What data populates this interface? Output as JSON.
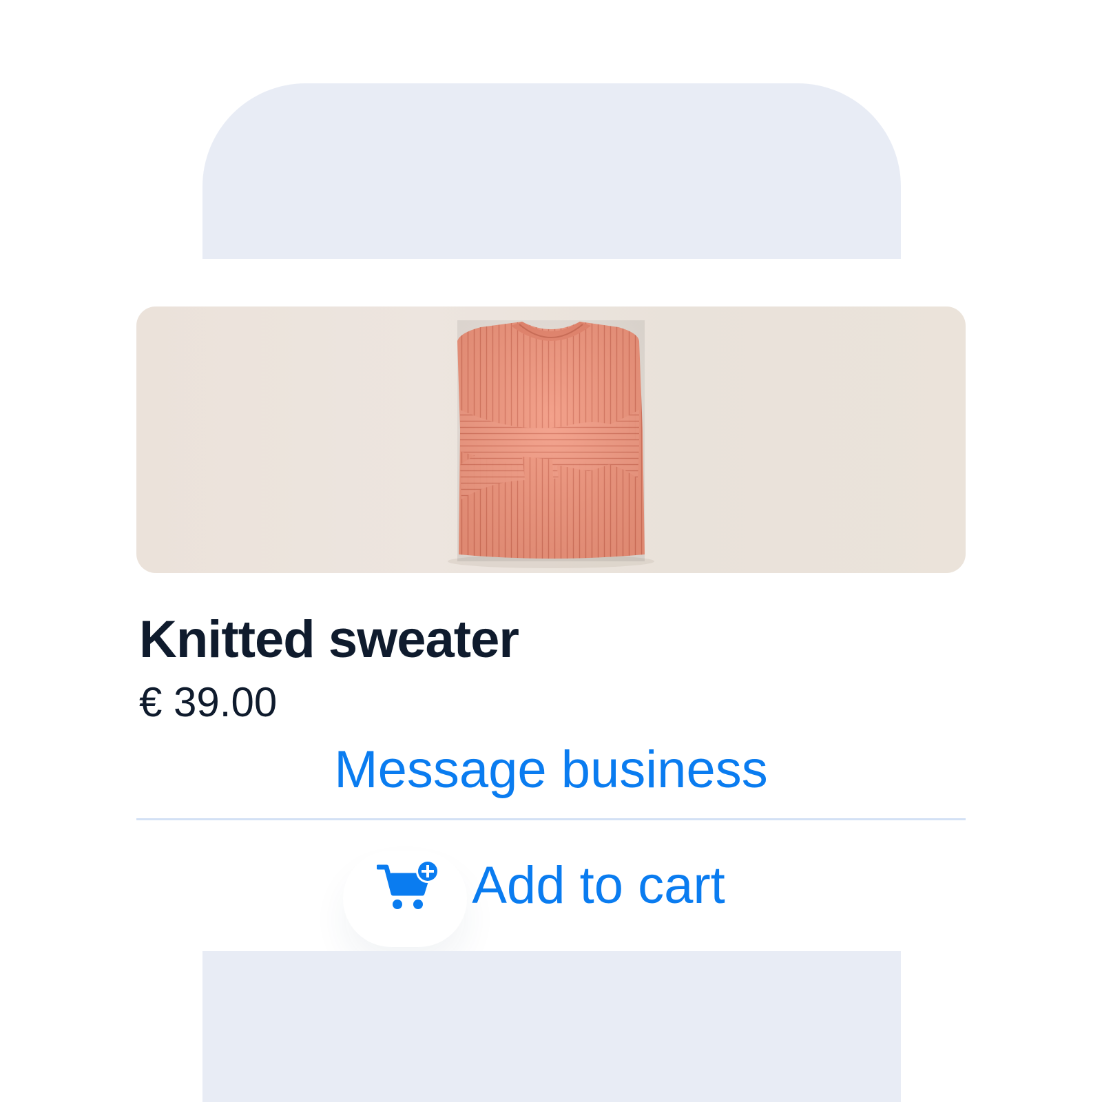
{
  "product": {
    "image_alt": "Folded knitted coral sweater",
    "title": "Knitted sweater",
    "price": "€ 39.00"
  },
  "actions": {
    "message_label": "Message business",
    "add_to_cart_label": "Add to cart",
    "add_to_cart_icon": "cart-plus-icon"
  },
  "colors": {
    "accent": "#0a7cf0",
    "title_text": "#0f1b2d",
    "phone_frame": "#e8ecf5",
    "divider": "#d3e1f5",
    "sweater": "#f2957c"
  }
}
